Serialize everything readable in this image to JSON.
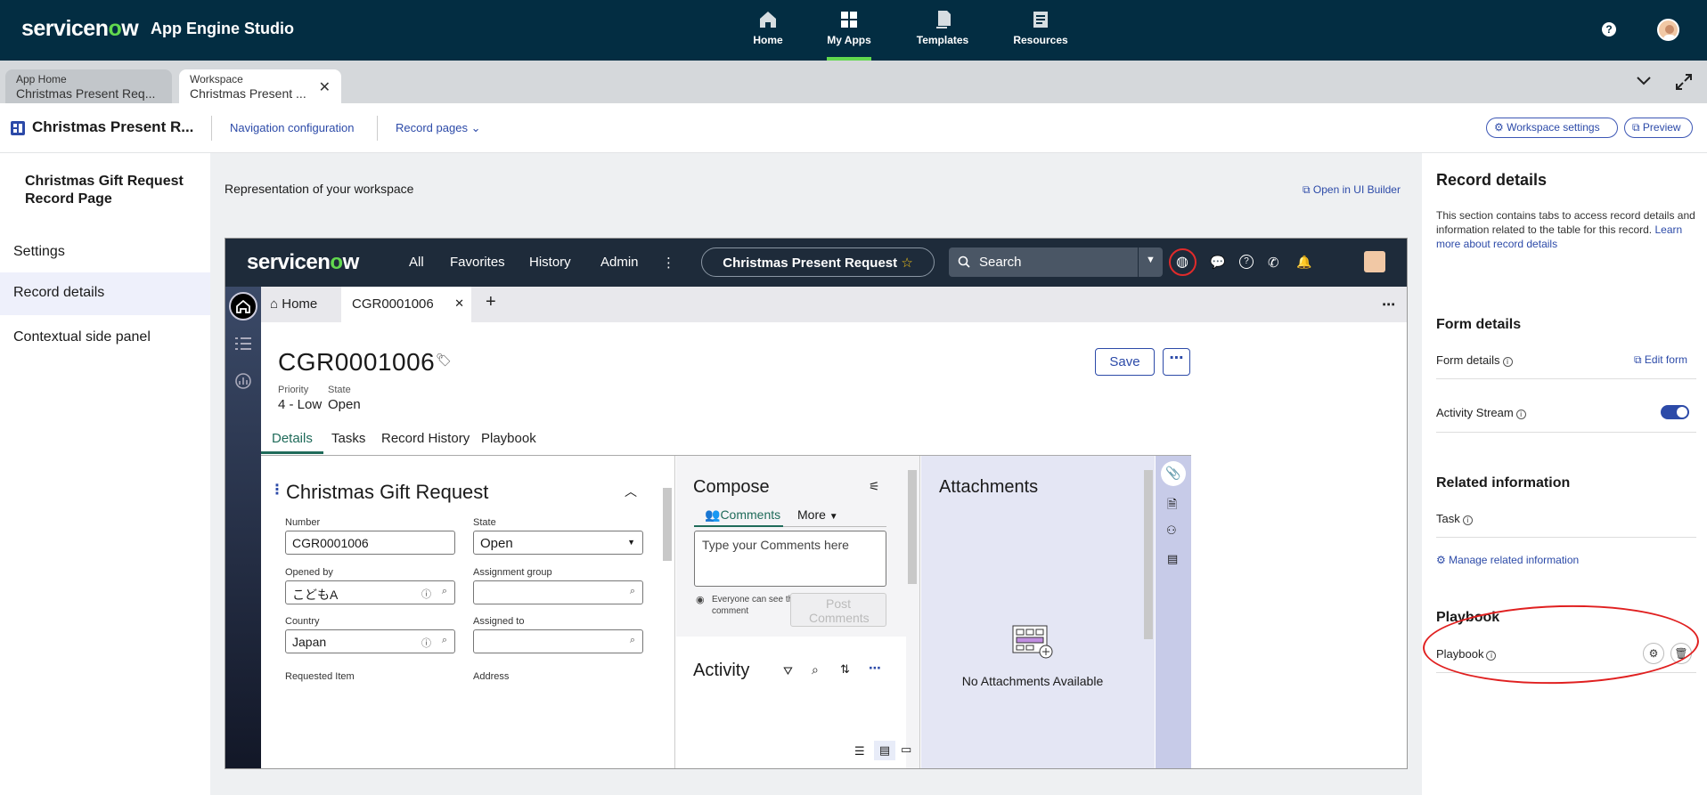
{
  "topbar": {
    "brand": "servicenow",
    "app_name": "App Engine Studio",
    "nav": [
      {
        "label": "Home",
        "icon": "home-icon"
      },
      {
        "label": "My Apps",
        "icon": "grid-icon",
        "active": true
      },
      {
        "label": "Templates",
        "icon": "templates-icon"
      },
      {
        "label": "Resources",
        "icon": "resources-icon"
      }
    ],
    "accent": "#62d84e",
    "background": "#032d42"
  },
  "apptabs": [
    {
      "top": "App Home",
      "bottom": "Christmas Present Req..."
    },
    {
      "top": "Workspace",
      "bottom": "Christmas Present ..."
    }
  ],
  "header": {
    "title": "Christmas Present R...",
    "nav_config": "Navigation configuration",
    "record_pages": "Record pages",
    "workspace_settings": "Workspace settings",
    "preview": "Preview"
  },
  "leftnav": {
    "title": "Christmas Gift Request Record Page",
    "items": [
      "Settings",
      "Record details",
      "Contextual side panel"
    ]
  },
  "center": {
    "representation": "Representation of your workspace",
    "open_ui_builder": "Open in UI Builder"
  },
  "inner": {
    "logo": "servicenow",
    "nav": [
      "All",
      "Favorites",
      "History",
      "Admin"
    ],
    "context": "Christmas Present Request",
    "search_placeholder": "Search",
    "tabs": [
      "Home",
      "CGR0001006"
    ],
    "record_number": "CGR0001006",
    "priority_label": "Priority",
    "priority_value": "4 - Low",
    "state_label": "State",
    "state_value": "Open",
    "save": "Save",
    "record_tabs": [
      "Details",
      "Tasks",
      "Record History",
      "Playbook"
    ],
    "form": {
      "title": "Christmas Gift Request",
      "fields": [
        {
          "label": "Number",
          "value": "CGR0001006"
        },
        {
          "label": "State",
          "value": "Open"
        },
        {
          "label": "Opened by",
          "value": "こどもA"
        },
        {
          "label": "Assignment group",
          "value": ""
        },
        {
          "label": "Country",
          "value": "Japan"
        },
        {
          "label": "Assigned to",
          "value": ""
        },
        {
          "label": "Requested Item",
          "value": ""
        },
        {
          "label": "Address",
          "value": ""
        }
      ]
    },
    "compose": {
      "title": "Compose",
      "comments_tab": "Comments",
      "more": "More",
      "placeholder": "Type your Comments here",
      "visibility_note": "Everyone can see this comment",
      "post": "Post Comments",
      "activity": "Activity"
    },
    "attachments": {
      "title": "Attachments",
      "empty": "No Attachments Available"
    }
  },
  "rightpanel": {
    "title": "Record details",
    "desc": "This section contains tabs to access record details and information related to the table for this record.",
    "learn_more": "Learn more about record details",
    "form_details_h": "Form details",
    "form_details_label": "Form details",
    "edit_form": "Edit form",
    "activity_stream": "Activity Stream",
    "activity_stream_on": true,
    "related_h": "Related information",
    "task": "Task",
    "manage_related": "Manage related information",
    "playbook_h": "Playbook",
    "playbook_label": "Playbook"
  }
}
